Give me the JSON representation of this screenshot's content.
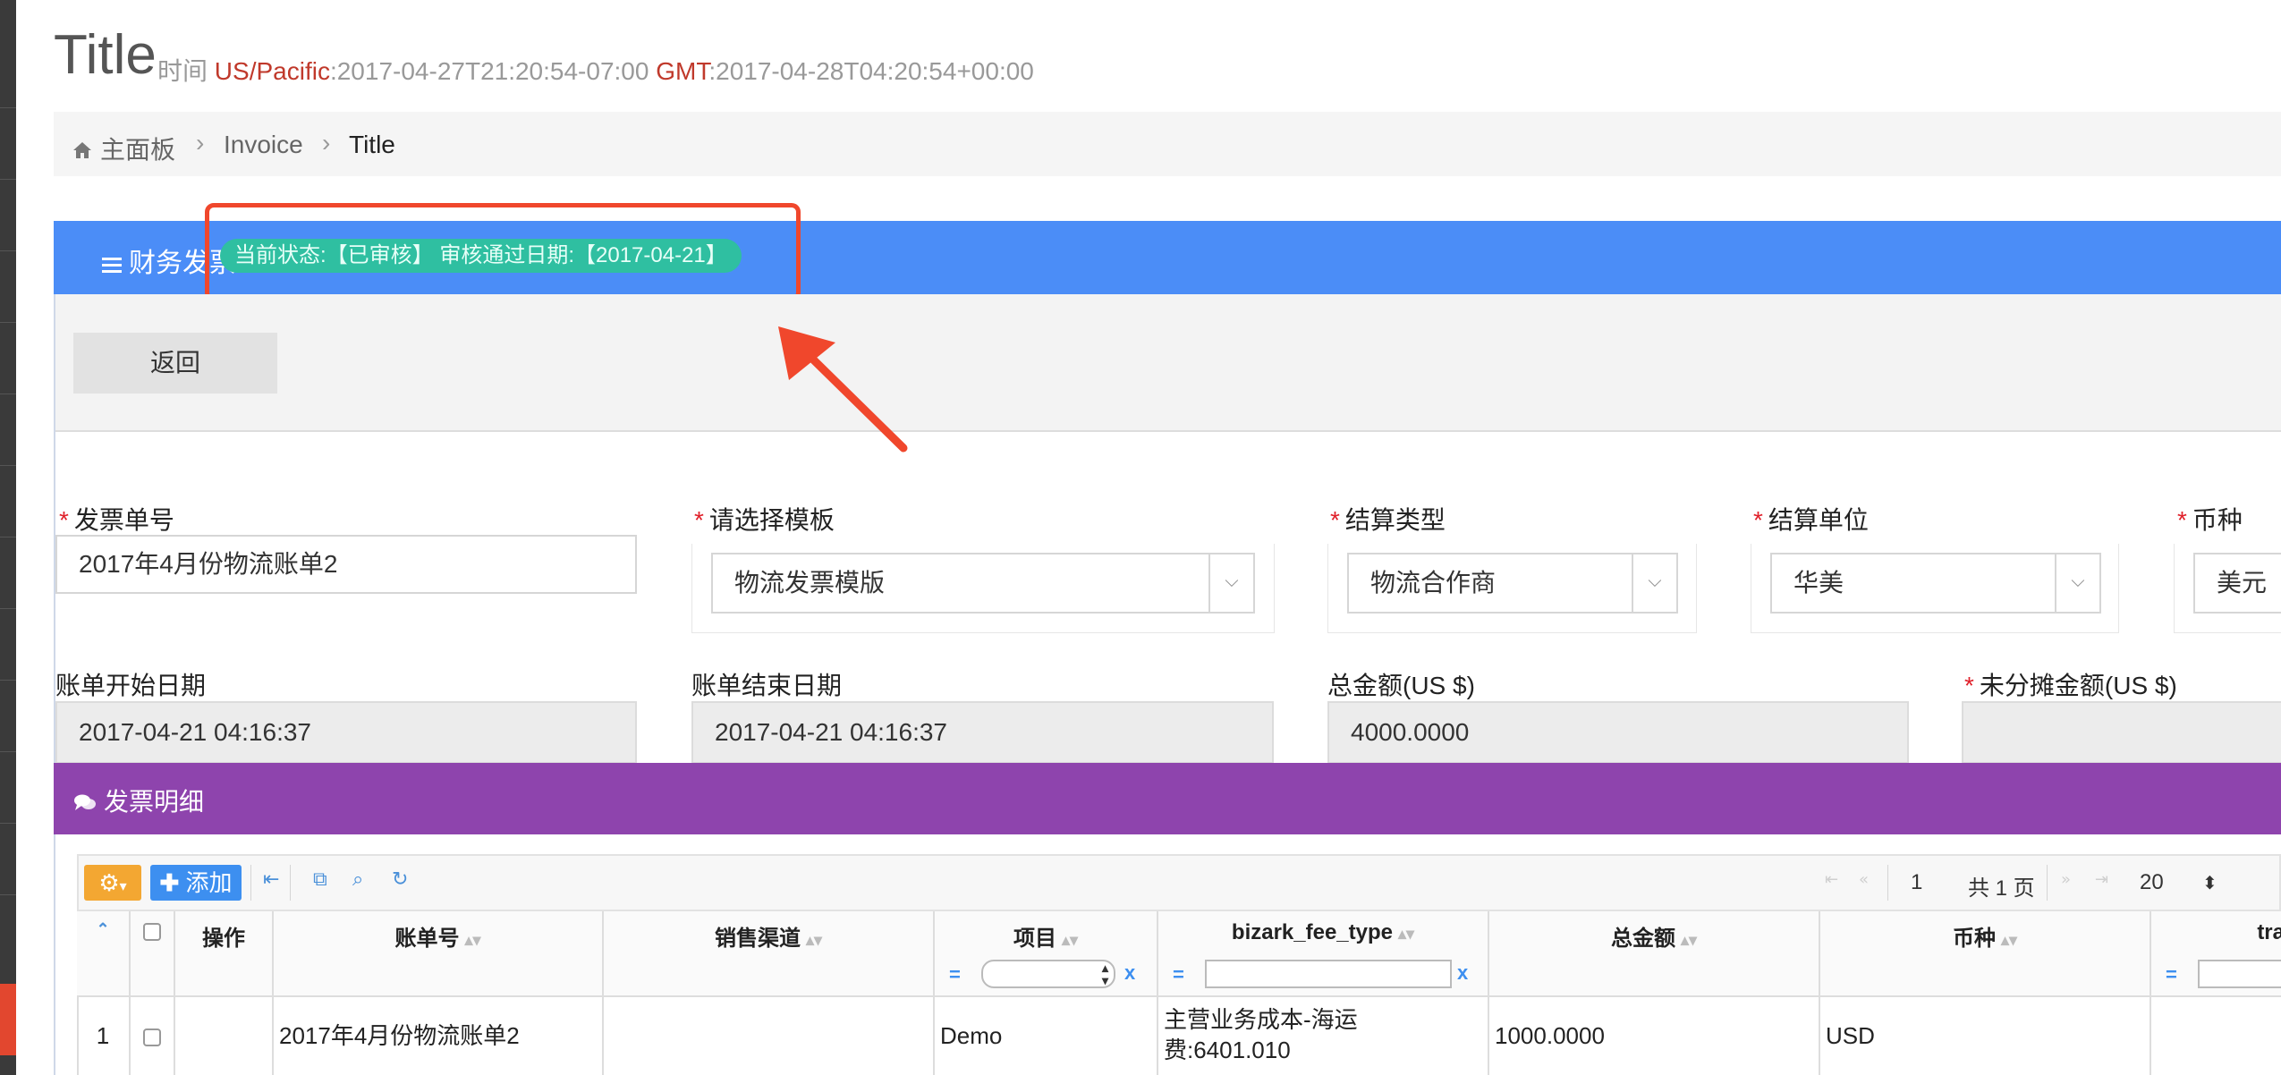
{
  "header": {
    "title": "Title",
    "time_label": "时间",
    "tz1": "US/Pacific",
    "time1": ":2017-04-27T21:20:54-07:00",
    "tz2": "GMT",
    "time2": ":2017-04-28T04:20:54+00:00"
  },
  "breadcrumb": {
    "home": "主面板",
    "invoice": "Invoice",
    "current": "Title"
  },
  "panel": {
    "title": "财务发票",
    "status_badge": "当前状态:【已审核】 审核通过日期:【2017-04-21】",
    "back_label": "返回"
  },
  "form": {
    "invoice_no_label": "发票单号",
    "invoice_no_value": "2017年4月份物流账单2",
    "template_label": "请选择模板",
    "template_value": "物流发票模版",
    "settle_type_label": "结算类型",
    "settle_type_value": "物流合作商",
    "settle_unit_label": "结算单位",
    "settle_unit_value": "华美",
    "currency_label": "币种",
    "currency_value": "美元",
    "start_date_label": "账单开始日期",
    "start_date_value": "2017-04-21 04:16:37",
    "end_date_label": "账单结束日期",
    "end_date_value": "2017-04-21 04:16:37",
    "total_label": "总金额(US $)",
    "total_value": "4000.0000",
    "unalloc_label": "未分摊金额(US $)",
    "unalloc_value": ""
  },
  "detail": {
    "title": "发票明细",
    "add_label": "添加",
    "page_input": "1",
    "page_total": "共 1 页",
    "page_size": "20",
    "columns": [
      "操作",
      "账单号",
      "销售渠道",
      "项目",
      "bizark_fee_type",
      "总金额",
      "币种",
      "tra"
    ],
    "rows": [
      {
        "num": "1",
        "bill_no": "2017年4月份物流账单2",
        "channel": "",
        "project": "Demo",
        "fee_type_1": "主营业务成本-海运",
        "fee_type_2": "费:6401.010",
        "total": "1000.0000",
        "currency": "USD"
      }
    ]
  }
}
